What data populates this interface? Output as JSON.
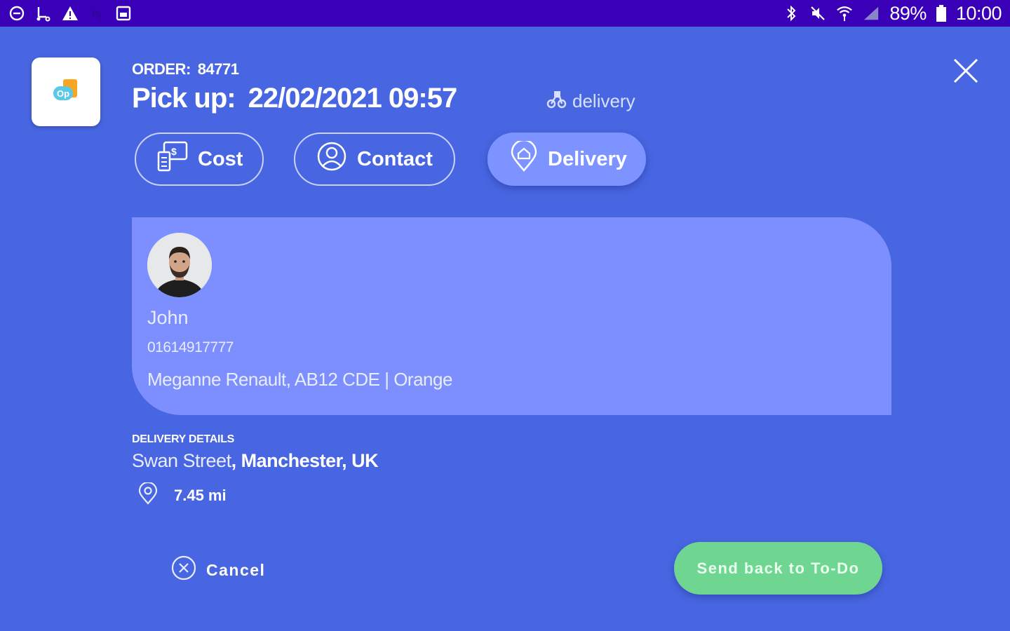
{
  "status_bar": {
    "battery": "89%",
    "time": "10:00",
    "left_icons": [
      "do-not-disturb-icon",
      "scooter-icon",
      "warning-icon",
      "app-icon",
      "image-icon"
    ],
    "right_icons": [
      "bluetooth-icon",
      "mute-icon",
      "wifi-icon",
      "signal-icon",
      "battery-icon"
    ]
  },
  "header": {
    "order_label": "ORDER:",
    "order_number": "84771",
    "pickup_label": "Pick up:",
    "pickup_datetime": "22/02/2021 09:57",
    "service_type": "delivery"
  },
  "tabs": [
    {
      "label": "Cost",
      "icon": "cost-icon",
      "active": false
    },
    {
      "label": "Contact",
      "icon": "contact-icon",
      "active": false
    },
    {
      "label": "Delivery",
      "icon": "delivery-location-icon",
      "active": true
    }
  ],
  "contact_card": {
    "name": "John",
    "phone": "01614917777",
    "vehicle": "Meganne Renault, AB12 CDE | Orange"
  },
  "delivery_details": {
    "title": "DELIVERY DETAILS",
    "street": "Swan Street",
    "city": ", Manchester, UK",
    "distance": "7.45 mi"
  },
  "actions": {
    "cancel_label": "Cancel",
    "send_back_label": "Send back to To-Do"
  },
  "colors": {
    "background": "#4866e1",
    "status_bar": "#3a00b8",
    "card": "#7d8ffe",
    "accent_green": "#6fd691"
  }
}
